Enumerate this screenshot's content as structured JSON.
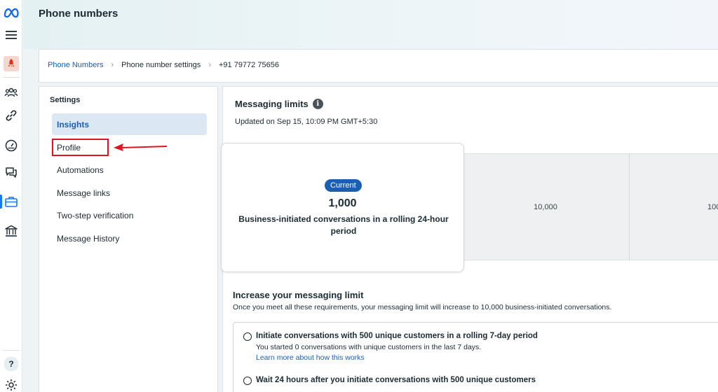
{
  "header": {
    "title": "Phone numbers"
  },
  "breadcrumb": [
    {
      "label": "Phone Numbers"
    },
    {
      "label": "Phone number settings"
    },
    {
      "label": "+91 79772 75656"
    }
  ],
  "settings": {
    "heading": "Settings",
    "items": [
      {
        "label": "Insights",
        "active": true
      },
      {
        "label": "Profile",
        "active": false
      },
      {
        "label": "Automations",
        "active": false
      },
      {
        "label": "Message links",
        "active": false
      },
      {
        "label": "Two-step verification",
        "active": false
      },
      {
        "label": "Message History",
        "active": false
      }
    ]
  },
  "messaging_limits": {
    "title": "Messaging limits",
    "updated": "Updated on Sep 15, 10:09 PM GMT+5:30",
    "current_badge": "Current",
    "current_value": "1,000",
    "current_description": "Business-initiated conversations in a rolling 24-hour period",
    "tiers": [
      "10,000",
      "100"
    ]
  },
  "increase": {
    "title": "Increase your messaging limit",
    "description": "Once you meet all these requirements, your messaging limit will increase to 10,000 business-initiated conversations.",
    "requirements": [
      {
        "title": "Initiate conversations with 500 unique customers in a rolling 7-day period",
        "subtitle": "You started 0 conversations with unique customers in the last 7 days.",
        "link": "Learn more about how this works"
      },
      {
        "title": "Wait 24 hours after you initiate conversations with 500 unique customers"
      }
    ]
  },
  "colors": {
    "accent": "#1b5fb4",
    "annotation": "#e0141f"
  }
}
